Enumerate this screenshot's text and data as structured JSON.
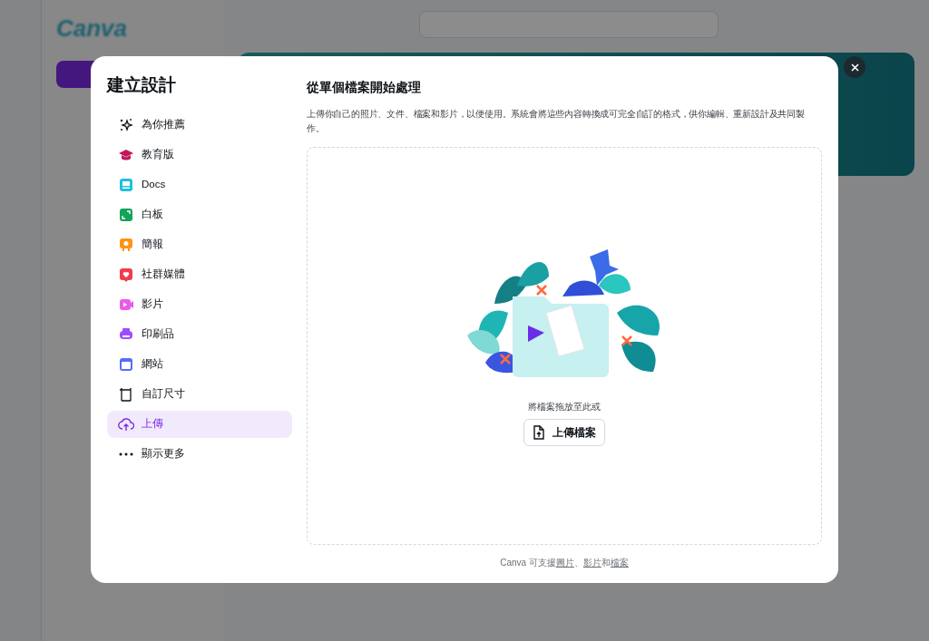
{
  "app": {
    "logo": "Canva"
  },
  "dialog": {
    "title": "建立設計",
    "menu": [
      {
        "label": "為你推薦",
        "selected": false
      },
      {
        "label": "教育版",
        "selected": false
      },
      {
        "label": "Docs",
        "selected": false
      },
      {
        "label": "白板",
        "selected": false
      },
      {
        "label": "簡報",
        "selected": false
      },
      {
        "label": "社群媒體",
        "selected": false
      },
      {
        "label": "影片",
        "selected": false
      },
      {
        "label": "印刷品",
        "selected": false
      },
      {
        "label": "網站",
        "selected": false
      },
      {
        "label": "自訂尺寸",
        "selected": false
      },
      {
        "label": "上傳",
        "selected": true
      },
      {
        "label": "顯示更多",
        "selected": false
      }
    ],
    "heading": "從單個檔案開始處理",
    "description": "上傳你自己的照片、文件、檔案和影片，以便使用。系統會將這些內容轉換成可完全自訂的格式，供你編輯、重新設計及共同製作。",
    "drop_hint": "將檔案拖放至此或",
    "upload_button": "上傳檔案",
    "footer": [
      {
        "text": "Canva 可支援",
        "link": false
      },
      {
        "text": "圖片",
        "link": true
      },
      {
        "text": "、",
        "link": false
      },
      {
        "text": "影片",
        "link": true
      },
      {
        "text": "和",
        "link": false
      },
      {
        "text": "檔案",
        "link": true
      }
    ]
  }
}
